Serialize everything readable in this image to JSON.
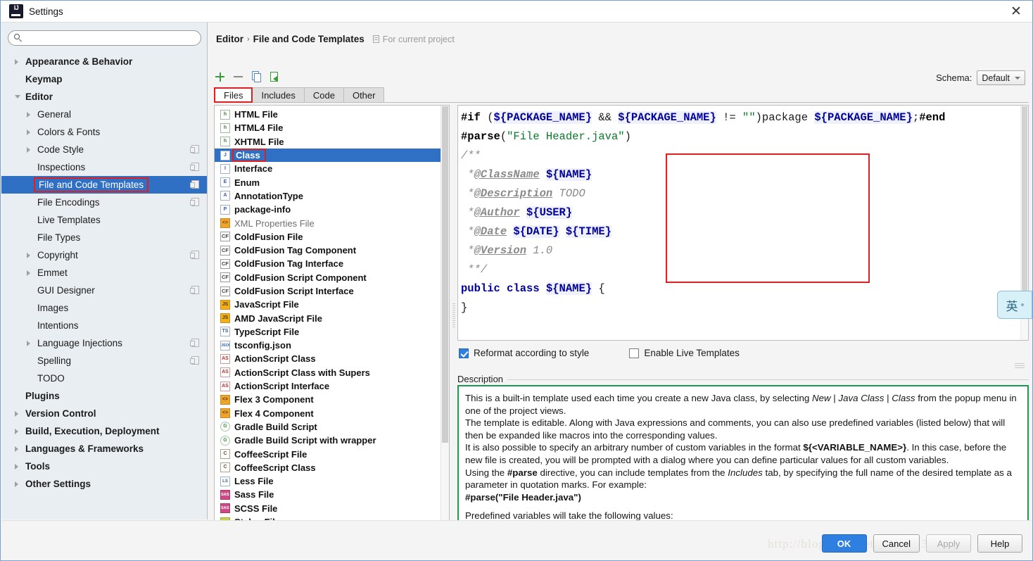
{
  "window": {
    "title": "Settings",
    "logo_icon": "intellij-idea-logo",
    "close_icon": "close-icon"
  },
  "search": {
    "placeholder": "",
    "value": "",
    "icon": "search-icon"
  },
  "sidebar": {
    "items": [
      {
        "label": "Appearance & Behavior",
        "depth": 0,
        "arrow": "collapsed",
        "badge": false,
        "selected": false
      },
      {
        "label": "Keymap",
        "depth": 0,
        "arrow": "none",
        "badge": false,
        "selected": false
      },
      {
        "label": "Editor",
        "depth": 0,
        "arrow": "expanded",
        "badge": false,
        "selected": false
      },
      {
        "label": "General",
        "depth": 1,
        "arrow": "collapsed",
        "badge": false,
        "selected": false
      },
      {
        "label": "Colors & Fonts",
        "depth": 1,
        "arrow": "collapsed",
        "badge": false,
        "selected": false
      },
      {
        "label": "Code Style",
        "depth": 1,
        "arrow": "collapsed",
        "badge": true,
        "selected": false
      },
      {
        "label": "Inspections",
        "depth": 1,
        "arrow": "none",
        "badge": true,
        "selected": false
      },
      {
        "label": "File and Code Templates",
        "depth": 1,
        "arrow": "none",
        "badge": true,
        "selected": true
      },
      {
        "label": "File Encodings",
        "depth": 1,
        "arrow": "none",
        "badge": true,
        "selected": false
      },
      {
        "label": "Live Templates",
        "depth": 1,
        "arrow": "none",
        "badge": false,
        "selected": false
      },
      {
        "label": "File Types",
        "depth": 1,
        "arrow": "none",
        "badge": false,
        "selected": false
      },
      {
        "label": "Copyright",
        "depth": 1,
        "arrow": "collapsed",
        "badge": true,
        "selected": false
      },
      {
        "label": "Emmet",
        "depth": 1,
        "arrow": "collapsed",
        "badge": false,
        "selected": false
      },
      {
        "label": "GUI Designer",
        "depth": 1,
        "arrow": "none",
        "badge": true,
        "selected": false
      },
      {
        "label": "Images",
        "depth": 1,
        "arrow": "none",
        "badge": false,
        "selected": false
      },
      {
        "label": "Intentions",
        "depth": 1,
        "arrow": "none",
        "badge": false,
        "selected": false
      },
      {
        "label": "Language Injections",
        "depth": 1,
        "arrow": "collapsed",
        "badge": true,
        "selected": false
      },
      {
        "label": "Spelling",
        "depth": 1,
        "arrow": "none",
        "badge": true,
        "selected": false
      },
      {
        "label": "TODO",
        "depth": 1,
        "arrow": "none",
        "badge": false,
        "selected": false
      },
      {
        "label": "Plugins",
        "depth": 0,
        "arrow": "none",
        "badge": false,
        "selected": false
      },
      {
        "label": "Version Control",
        "depth": 0,
        "arrow": "collapsed",
        "badge": false,
        "selected": false
      },
      {
        "label": "Build, Execution, Deployment",
        "depth": 0,
        "arrow": "collapsed",
        "badge": false,
        "selected": false
      },
      {
        "label": "Languages & Frameworks",
        "depth": 0,
        "arrow": "collapsed",
        "badge": false,
        "selected": false
      },
      {
        "label": "Tools",
        "depth": 0,
        "arrow": "collapsed",
        "badge": false,
        "selected": false
      },
      {
        "label": "Other Settings",
        "depth": 0,
        "arrow": "collapsed",
        "badge": false,
        "selected": false
      }
    ]
  },
  "breadcrumb": {
    "root": "Editor",
    "separator": "›",
    "current": "File and Code Templates",
    "scope_note": "For current project",
    "scope_icon": "project-scope-icon"
  },
  "schema": {
    "label": "Schema:",
    "value": "Default"
  },
  "toolbar": {
    "add_icon": "plus-icon",
    "remove_icon": "minus-icon",
    "copy_icon": "copy-icon",
    "reset_icon": "reset-template-icon"
  },
  "tabs": [
    {
      "label": "Files",
      "active": true
    },
    {
      "label": "Includes",
      "active": false
    },
    {
      "label": "Code",
      "active": false
    },
    {
      "label": "Other",
      "active": false
    }
  ],
  "file_list": [
    {
      "label": "HTML File",
      "icon": "html-file-icon",
      "icon_class": "ic-html",
      "icon_text": "h",
      "dim": false,
      "selected": false
    },
    {
      "label": "HTML4 File",
      "icon": "html4-file-icon",
      "icon_class": "ic-html",
      "icon_text": "h",
      "dim": false,
      "selected": false
    },
    {
      "label": "XHTML File",
      "icon": "xhtml-file-icon",
      "icon_class": "ic-html",
      "icon_text": "h",
      "dim": false,
      "selected": false
    },
    {
      "label": "Class",
      "icon": "java-class-icon",
      "icon_class": "ic-java",
      "icon_text": "J",
      "dim": false,
      "selected": true
    },
    {
      "label": "Interface",
      "icon": "java-interface-icon",
      "icon_class": "ic-java",
      "icon_text": "I",
      "dim": false,
      "selected": false
    },
    {
      "label": "Enum",
      "icon": "java-enum-icon",
      "icon_class": "ic-java",
      "icon_text": "E",
      "dim": false,
      "selected": false
    },
    {
      "label": "AnnotationType",
      "icon": "java-annotation-icon",
      "icon_class": "ic-java",
      "icon_text": "A",
      "dim": false,
      "selected": false
    },
    {
      "label": "package-info",
      "icon": "java-package-icon",
      "icon_class": "ic-java",
      "icon_text": "P",
      "dim": false,
      "selected": false
    },
    {
      "label": "XML Properties File",
      "icon": "xml-properties-icon",
      "icon_class": "ic-xml",
      "icon_text": "<>",
      "dim": true,
      "selected": false
    },
    {
      "label": "ColdFusion File",
      "icon": "coldfusion-file-icon",
      "icon_class": "ic-cf",
      "icon_text": "CF",
      "dim": false,
      "selected": false
    },
    {
      "label": "ColdFusion Tag Component",
      "icon": "coldfusion-tag-component-icon",
      "icon_class": "ic-cf",
      "icon_text": "CF",
      "dim": false,
      "selected": false
    },
    {
      "label": "ColdFusion Tag Interface",
      "icon": "coldfusion-tag-interface-icon",
      "icon_class": "ic-cf",
      "icon_text": "CF",
      "dim": false,
      "selected": false
    },
    {
      "label": "ColdFusion Script Component",
      "icon": "coldfusion-script-component-icon",
      "icon_class": "ic-cf",
      "icon_text": "CF",
      "dim": false,
      "selected": false
    },
    {
      "label": "ColdFusion Script Interface",
      "icon": "coldfusion-script-interface-icon",
      "icon_class": "ic-cf",
      "icon_text": "CF",
      "dim": false,
      "selected": false
    },
    {
      "label": "JavaScript File",
      "icon": "javascript-file-icon",
      "icon_class": "ic-js",
      "icon_text": "JS",
      "dim": false,
      "selected": false
    },
    {
      "label": "AMD JavaScript File",
      "icon": "amd-javascript-file-icon",
      "icon_class": "ic-js",
      "icon_text": "JS",
      "dim": false,
      "selected": false
    },
    {
      "label": "TypeScript File",
      "icon": "typescript-file-icon",
      "icon_class": "ic-ts",
      "icon_text": "TS",
      "dim": false,
      "selected": false
    },
    {
      "label": "tsconfig.json",
      "icon": "tsconfig-json-icon",
      "icon_class": "ic-json",
      "icon_text": "JSON",
      "dim": false,
      "selected": false
    },
    {
      "label": "ActionScript Class",
      "icon": "actionscript-class-icon",
      "icon_class": "ic-as",
      "icon_text": "AS",
      "dim": false,
      "selected": false
    },
    {
      "label": "ActionScript Class with Supers",
      "icon": "actionscript-class-supers-icon",
      "icon_class": "ic-as",
      "icon_text": "AS",
      "dim": false,
      "selected": false
    },
    {
      "label": "ActionScript Interface",
      "icon": "actionscript-interface-icon",
      "icon_class": "ic-as",
      "icon_text": "AS",
      "dim": false,
      "selected": false
    },
    {
      "label": "Flex 3 Component",
      "icon": "flex3-component-icon",
      "icon_class": "ic-flex",
      "icon_text": "<>",
      "dim": false,
      "selected": false
    },
    {
      "label": "Flex 4 Component",
      "icon": "flex4-component-icon",
      "icon_class": "ic-flex",
      "icon_text": "<>",
      "dim": false,
      "selected": false
    },
    {
      "label": "Gradle Build Script",
      "icon": "gradle-build-script-icon",
      "icon_class": "ic-gradle",
      "icon_text": "G",
      "dim": false,
      "selected": false
    },
    {
      "label": "Gradle Build Script with wrapper",
      "icon": "gradle-build-script-wrapper-icon",
      "icon_class": "ic-gradle",
      "icon_text": "G",
      "dim": false,
      "selected": false
    },
    {
      "label": "CoffeeScript File",
      "icon": "coffeescript-file-icon",
      "icon_class": "ic-coffee",
      "icon_text": "C",
      "dim": false,
      "selected": false
    },
    {
      "label": "CoffeeScript Class",
      "icon": "coffeescript-class-icon",
      "icon_class": "ic-coffee",
      "icon_text": "C",
      "dim": false,
      "selected": false
    },
    {
      "label": "Less File",
      "icon": "less-file-icon",
      "icon_class": "ic-less",
      "icon_text": "LS",
      "dim": false,
      "selected": false
    },
    {
      "label": "Sass File",
      "icon": "sass-file-icon",
      "icon_class": "ic-sass",
      "icon_text": "SASS",
      "dim": false,
      "selected": false
    },
    {
      "label": "SCSS File",
      "icon": "scss-file-icon",
      "icon_class": "ic-sass",
      "icon_text": "SASS",
      "dim": false,
      "selected": false
    },
    {
      "label": "Stylus File",
      "icon": "stylus-file-icon",
      "icon_class": "ic-stylus",
      "icon_text": "STYL",
      "dim": false,
      "selected": false
    }
  ],
  "editor": {
    "lines": [
      "#if (${PACKAGE_NAME} && ${PACKAGE_NAME} != \"\")package ${PACKAGE_NAME};#end",
      "#parse(\"File Header.java\")",
      "/**",
      " *@ClassName ${NAME}",
      " *@Description TODO",
      " *@Author ${USER}",
      " *@Date ${DATE} ${TIME}",
      " *@Version 1.0",
      " **/",
      "public class ${NAME} {",
      "}"
    ],
    "highlight_color": "#e02020"
  },
  "options": {
    "reformat": {
      "label": "Reformat according to style",
      "checked": true
    },
    "live_templates": {
      "label": "Enable Live Templates",
      "checked": false
    }
  },
  "description": {
    "label": "Description",
    "border_color": "#1d9a4e",
    "paragraphs": [
      [
        {
          "t": "This is a built-in template used each time you create a new Java class, by selecting ",
          "s": ""
        },
        {
          "t": "New",
          "s": "it"
        },
        {
          "t": " | ",
          "s": ""
        },
        {
          "t": "Java Class",
          "s": "it"
        },
        {
          "t": " | ",
          "s": ""
        },
        {
          "t": "Class",
          "s": "it"
        },
        {
          "t": " from the popup menu in one of the project views.",
          "s": ""
        }
      ],
      [
        {
          "t": "The template is editable. Along with Java expressions and comments, you can also use predefined variables (listed below) that will then be expanded like macros into the corresponding values.",
          "s": ""
        }
      ],
      [
        {
          "t": "It is also possible to specify an arbitrary number of custom variables in the format ",
          "s": ""
        },
        {
          "t": "${<VARIABLE_NAME>}",
          "s": "bo"
        },
        {
          "t": ". In this case, before the new file is created, you will be prompted with a dialog where you can define particular values for all custom variables.",
          "s": ""
        }
      ],
      [
        {
          "t": "Using the ",
          "s": ""
        },
        {
          "t": "#parse",
          "s": "bo"
        },
        {
          "t": " directive, you can include templates from the ",
          "s": ""
        },
        {
          "t": "Includes",
          "s": "it"
        },
        {
          "t": " tab, by specifying the full name of the desired template as a parameter in quotation marks. For example:",
          "s": ""
        }
      ],
      [
        {
          "t": "#parse(\"File Header.java\")",
          "s": "bo"
        }
      ],
      [
        {
          "t": "",
          "s": "spacer"
        }
      ],
      [
        {
          "t": "Predefined variables will take the following values:",
          "s": ""
        }
      ]
    ]
  },
  "footer": {
    "watermark": "http://blog.csdn.net/xiaoyu1314",
    "buttons": [
      {
        "label": "OK",
        "style": "primary"
      },
      {
        "label": "Cancel",
        "style": "normal"
      },
      {
        "label": "Apply",
        "style": "disabled"
      },
      {
        "label": "Help",
        "style": "normal"
      }
    ]
  },
  "ime": {
    "glyph": "英",
    "name": "ime-language-indicator"
  }
}
